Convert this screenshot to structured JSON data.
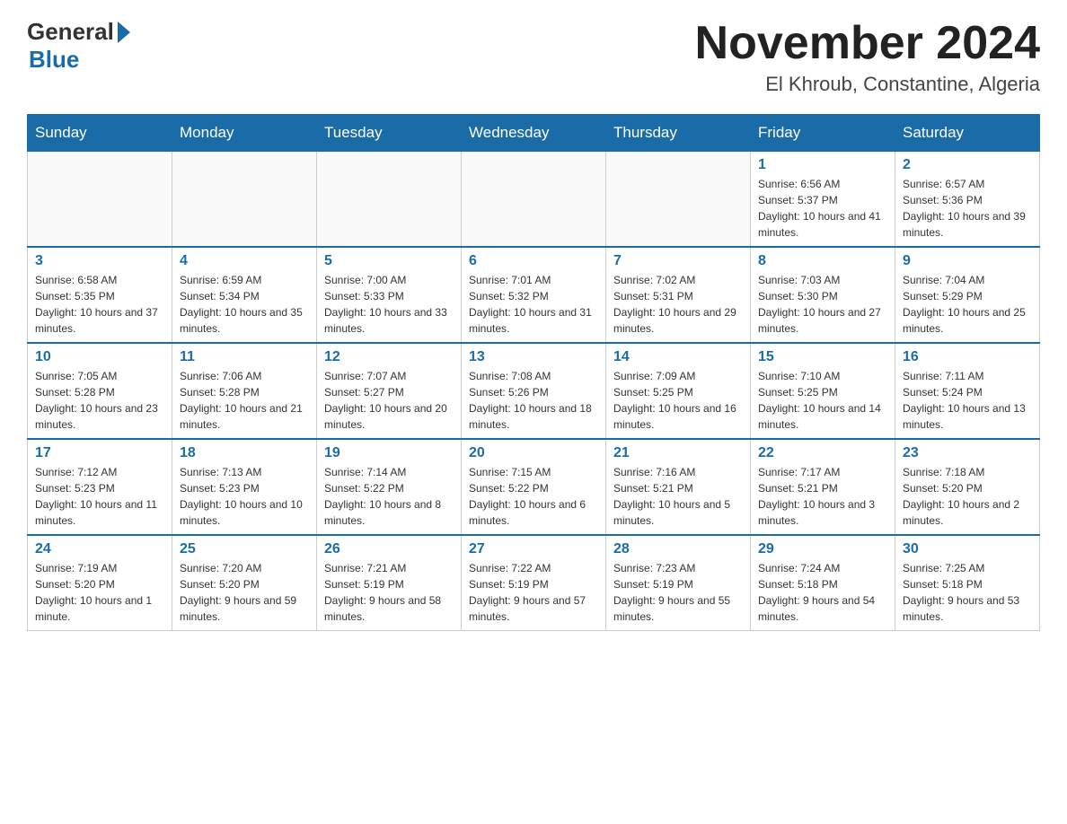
{
  "header": {
    "logo_general": "General",
    "logo_blue": "Blue",
    "month_title": "November 2024",
    "location": "El Khroub, Constantine, Algeria"
  },
  "weekdays": [
    "Sunday",
    "Monday",
    "Tuesday",
    "Wednesday",
    "Thursday",
    "Friday",
    "Saturday"
  ],
  "weeks": [
    [
      {
        "day": "",
        "info": ""
      },
      {
        "day": "",
        "info": ""
      },
      {
        "day": "",
        "info": ""
      },
      {
        "day": "",
        "info": ""
      },
      {
        "day": "",
        "info": ""
      },
      {
        "day": "1",
        "info": "Sunrise: 6:56 AM\nSunset: 5:37 PM\nDaylight: 10 hours and 41 minutes."
      },
      {
        "day": "2",
        "info": "Sunrise: 6:57 AM\nSunset: 5:36 PM\nDaylight: 10 hours and 39 minutes."
      }
    ],
    [
      {
        "day": "3",
        "info": "Sunrise: 6:58 AM\nSunset: 5:35 PM\nDaylight: 10 hours and 37 minutes."
      },
      {
        "day": "4",
        "info": "Sunrise: 6:59 AM\nSunset: 5:34 PM\nDaylight: 10 hours and 35 minutes."
      },
      {
        "day": "5",
        "info": "Sunrise: 7:00 AM\nSunset: 5:33 PM\nDaylight: 10 hours and 33 minutes."
      },
      {
        "day": "6",
        "info": "Sunrise: 7:01 AM\nSunset: 5:32 PM\nDaylight: 10 hours and 31 minutes."
      },
      {
        "day": "7",
        "info": "Sunrise: 7:02 AM\nSunset: 5:31 PM\nDaylight: 10 hours and 29 minutes."
      },
      {
        "day": "8",
        "info": "Sunrise: 7:03 AM\nSunset: 5:30 PM\nDaylight: 10 hours and 27 minutes."
      },
      {
        "day": "9",
        "info": "Sunrise: 7:04 AM\nSunset: 5:29 PM\nDaylight: 10 hours and 25 minutes."
      }
    ],
    [
      {
        "day": "10",
        "info": "Sunrise: 7:05 AM\nSunset: 5:28 PM\nDaylight: 10 hours and 23 minutes."
      },
      {
        "day": "11",
        "info": "Sunrise: 7:06 AM\nSunset: 5:28 PM\nDaylight: 10 hours and 21 minutes."
      },
      {
        "day": "12",
        "info": "Sunrise: 7:07 AM\nSunset: 5:27 PM\nDaylight: 10 hours and 20 minutes."
      },
      {
        "day": "13",
        "info": "Sunrise: 7:08 AM\nSunset: 5:26 PM\nDaylight: 10 hours and 18 minutes."
      },
      {
        "day": "14",
        "info": "Sunrise: 7:09 AM\nSunset: 5:25 PM\nDaylight: 10 hours and 16 minutes."
      },
      {
        "day": "15",
        "info": "Sunrise: 7:10 AM\nSunset: 5:25 PM\nDaylight: 10 hours and 14 minutes."
      },
      {
        "day": "16",
        "info": "Sunrise: 7:11 AM\nSunset: 5:24 PM\nDaylight: 10 hours and 13 minutes."
      }
    ],
    [
      {
        "day": "17",
        "info": "Sunrise: 7:12 AM\nSunset: 5:23 PM\nDaylight: 10 hours and 11 minutes."
      },
      {
        "day": "18",
        "info": "Sunrise: 7:13 AM\nSunset: 5:23 PM\nDaylight: 10 hours and 10 minutes."
      },
      {
        "day": "19",
        "info": "Sunrise: 7:14 AM\nSunset: 5:22 PM\nDaylight: 10 hours and 8 minutes."
      },
      {
        "day": "20",
        "info": "Sunrise: 7:15 AM\nSunset: 5:22 PM\nDaylight: 10 hours and 6 minutes."
      },
      {
        "day": "21",
        "info": "Sunrise: 7:16 AM\nSunset: 5:21 PM\nDaylight: 10 hours and 5 minutes."
      },
      {
        "day": "22",
        "info": "Sunrise: 7:17 AM\nSunset: 5:21 PM\nDaylight: 10 hours and 3 minutes."
      },
      {
        "day": "23",
        "info": "Sunrise: 7:18 AM\nSunset: 5:20 PM\nDaylight: 10 hours and 2 minutes."
      }
    ],
    [
      {
        "day": "24",
        "info": "Sunrise: 7:19 AM\nSunset: 5:20 PM\nDaylight: 10 hours and 1 minute."
      },
      {
        "day": "25",
        "info": "Sunrise: 7:20 AM\nSunset: 5:20 PM\nDaylight: 9 hours and 59 minutes."
      },
      {
        "day": "26",
        "info": "Sunrise: 7:21 AM\nSunset: 5:19 PM\nDaylight: 9 hours and 58 minutes."
      },
      {
        "day": "27",
        "info": "Sunrise: 7:22 AM\nSunset: 5:19 PM\nDaylight: 9 hours and 57 minutes."
      },
      {
        "day": "28",
        "info": "Sunrise: 7:23 AM\nSunset: 5:19 PM\nDaylight: 9 hours and 55 minutes."
      },
      {
        "day": "29",
        "info": "Sunrise: 7:24 AM\nSunset: 5:18 PM\nDaylight: 9 hours and 54 minutes."
      },
      {
        "day": "30",
        "info": "Sunrise: 7:25 AM\nSunset: 5:18 PM\nDaylight: 9 hours and 53 minutes."
      }
    ]
  ]
}
